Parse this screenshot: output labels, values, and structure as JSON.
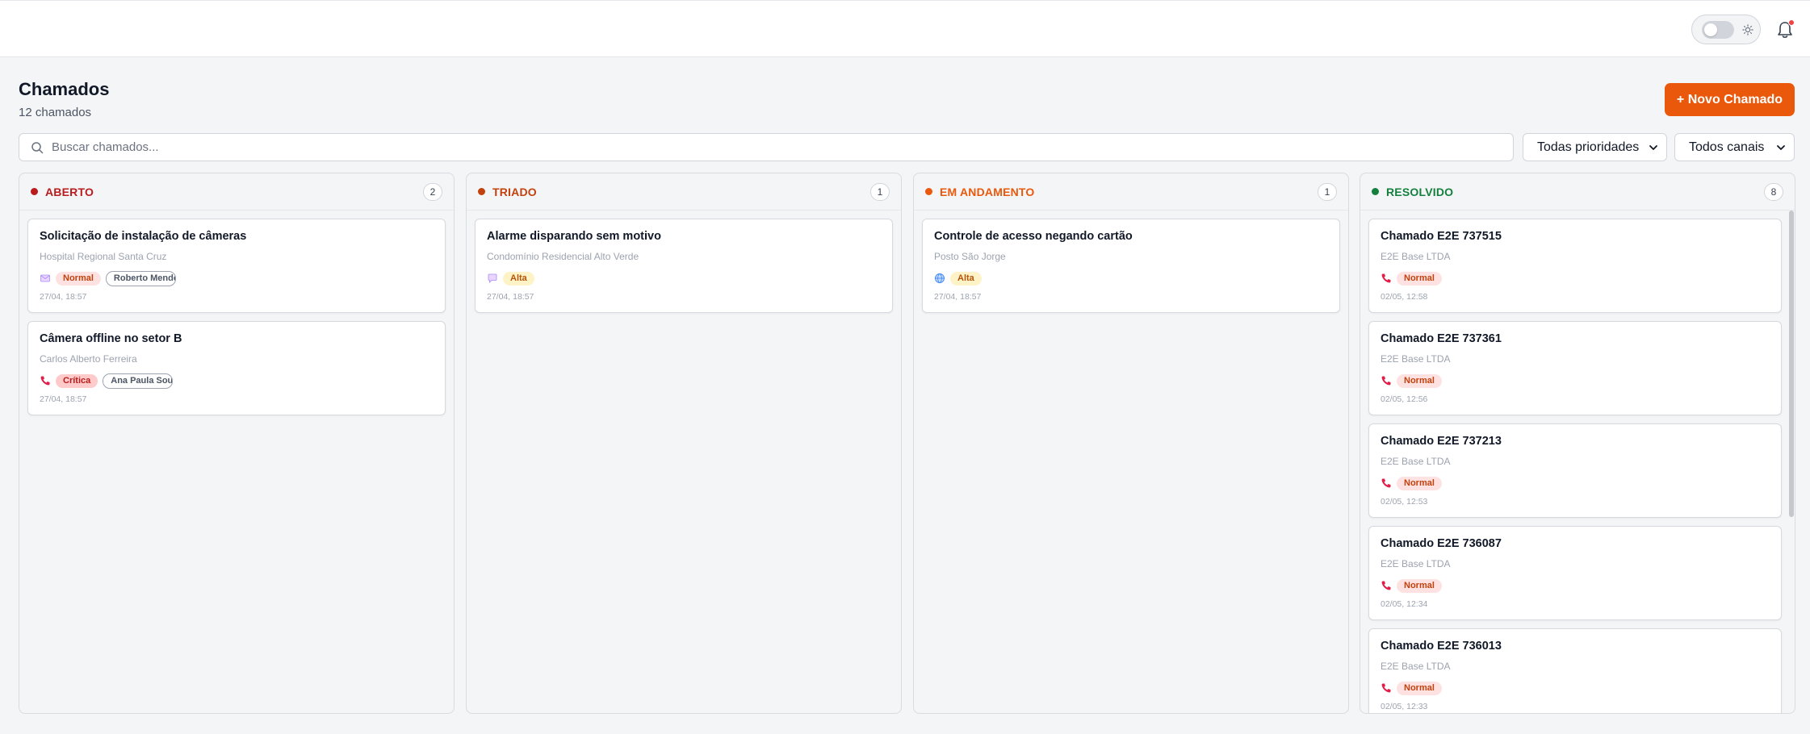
{
  "page": {
    "title": "Chamados",
    "subtitle": "12 chamados",
    "new_button": "+ Novo Chamado"
  },
  "search": {
    "placeholder": "Buscar chamados...",
    "value": ""
  },
  "filters": {
    "priority": "Todas prioridades",
    "channel": "Todos canais"
  },
  "colors": {
    "accent": "#ea580c",
    "aberto": "#b91c1c",
    "triado": "#c2410c",
    "em_andamento": "#ea580c",
    "resolvido": "#15803d"
  },
  "columns": [
    {
      "title": "ABERTO",
      "count": "2",
      "cards": [
        {
          "title": "Solicitação de instalação de câmeras",
          "client": "Hospital Regional Santa Cruz",
          "channel": "email-icon",
          "priority": "Normal",
          "assignee": "Roberto Mendes",
          "date": "27/04, 18:57"
        },
        {
          "title": "Câmera offline no setor B",
          "client": "Carlos Alberto Ferreira",
          "channel": "phone-icon",
          "priority": "Crítica",
          "assignee": "Ana Paula Souza",
          "date": "27/04, 18:57"
        }
      ]
    },
    {
      "title": "TRIADO",
      "count": "1",
      "cards": [
        {
          "title": "Alarme disparando sem motivo",
          "client": "Condomínio Residencial Alto Verde",
          "channel": "chat-icon",
          "priority": "Alta",
          "date": "27/04, 18:57"
        }
      ]
    },
    {
      "title": "EM ANDAMENTO",
      "count": "1",
      "cards": [
        {
          "title": "Controle de acesso negando cartão",
          "client": "Posto São Jorge",
          "channel": "globe-icon",
          "priority": "Alta",
          "date": "27/04, 18:57"
        }
      ]
    },
    {
      "title": "RESOLVIDO",
      "count": "8",
      "cards": [
        {
          "title": "Chamado E2E 737515",
          "client": "E2E Base LTDA",
          "channel": "phone-icon",
          "priority": "Normal",
          "date": "02/05, 12:58"
        },
        {
          "title": "Chamado E2E 737361",
          "client": "E2E Base LTDA",
          "channel": "phone-icon",
          "priority": "Normal",
          "date": "02/05, 12:56"
        },
        {
          "title": "Chamado E2E 737213",
          "client": "E2E Base LTDA",
          "channel": "phone-icon",
          "priority": "Normal",
          "date": "02/05, 12:53"
        },
        {
          "title": "Chamado E2E 736087",
          "client": "E2E Base LTDA",
          "channel": "phone-icon",
          "priority": "Normal",
          "date": "02/05, 12:34"
        },
        {
          "title": "Chamado E2E 736013",
          "client": "E2E Base LTDA",
          "channel": "phone-icon",
          "priority": "Normal",
          "date": "02/05, 12:33"
        }
      ]
    }
  ]
}
